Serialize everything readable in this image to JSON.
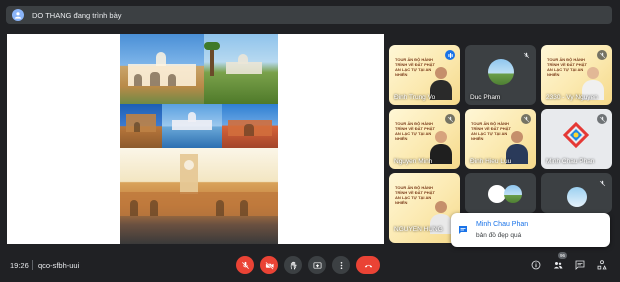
{
  "presenter": {
    "text": "DO THANG đang trình bày"
  },
  "participants": [
    {
      "name": "Đinh Trung Vo",
      "speaking": true
    },
    {
      "name": "Duc Pham",
      "speaking": false
    },
    {
      "name": "2330 - Vy Nguyen",
      "speaking": false
    },
    {
      "name": "Nguyen Minh",
      "speaking": false
    },
    {
      "name": "Đinh Hieu Luu",
      "speaking": false
    },
    {
      "name": "Minh Chau Phan",
      "speaking": false
    },
    {
      "name": "NGUYEN HUNG",
      "speaking": false
    }
  ],
  "slide_text": "TOUR ẤN ĐỘ HÀNH TRÌNH VỀ ĐẤT PHẬT AN LẠC TỰ TẠI AN NHIÊN",
  "chat_toast": {
    "sender": "Minh Chau Phan",
    "message": "bản đồ đẹp quá"
  },
  "meeting": {
    "time": "19:26",
    "code": "qco-sfbh-uui",
    "participant_count": "96"
  },
  "controls": {
    "mic": "mic-off-icon",
    "camera": "camera-off-icon",
    "raise_hand": "hand-icon",
    "present": "present-icon",
    "more": "more-icon",
    "end_call": "end-call-icon"
  },
  "colors": {
    "end_call": "#ea4335",
    "accent": "#1a73e8",
    "background": "#202124"
  }
}
